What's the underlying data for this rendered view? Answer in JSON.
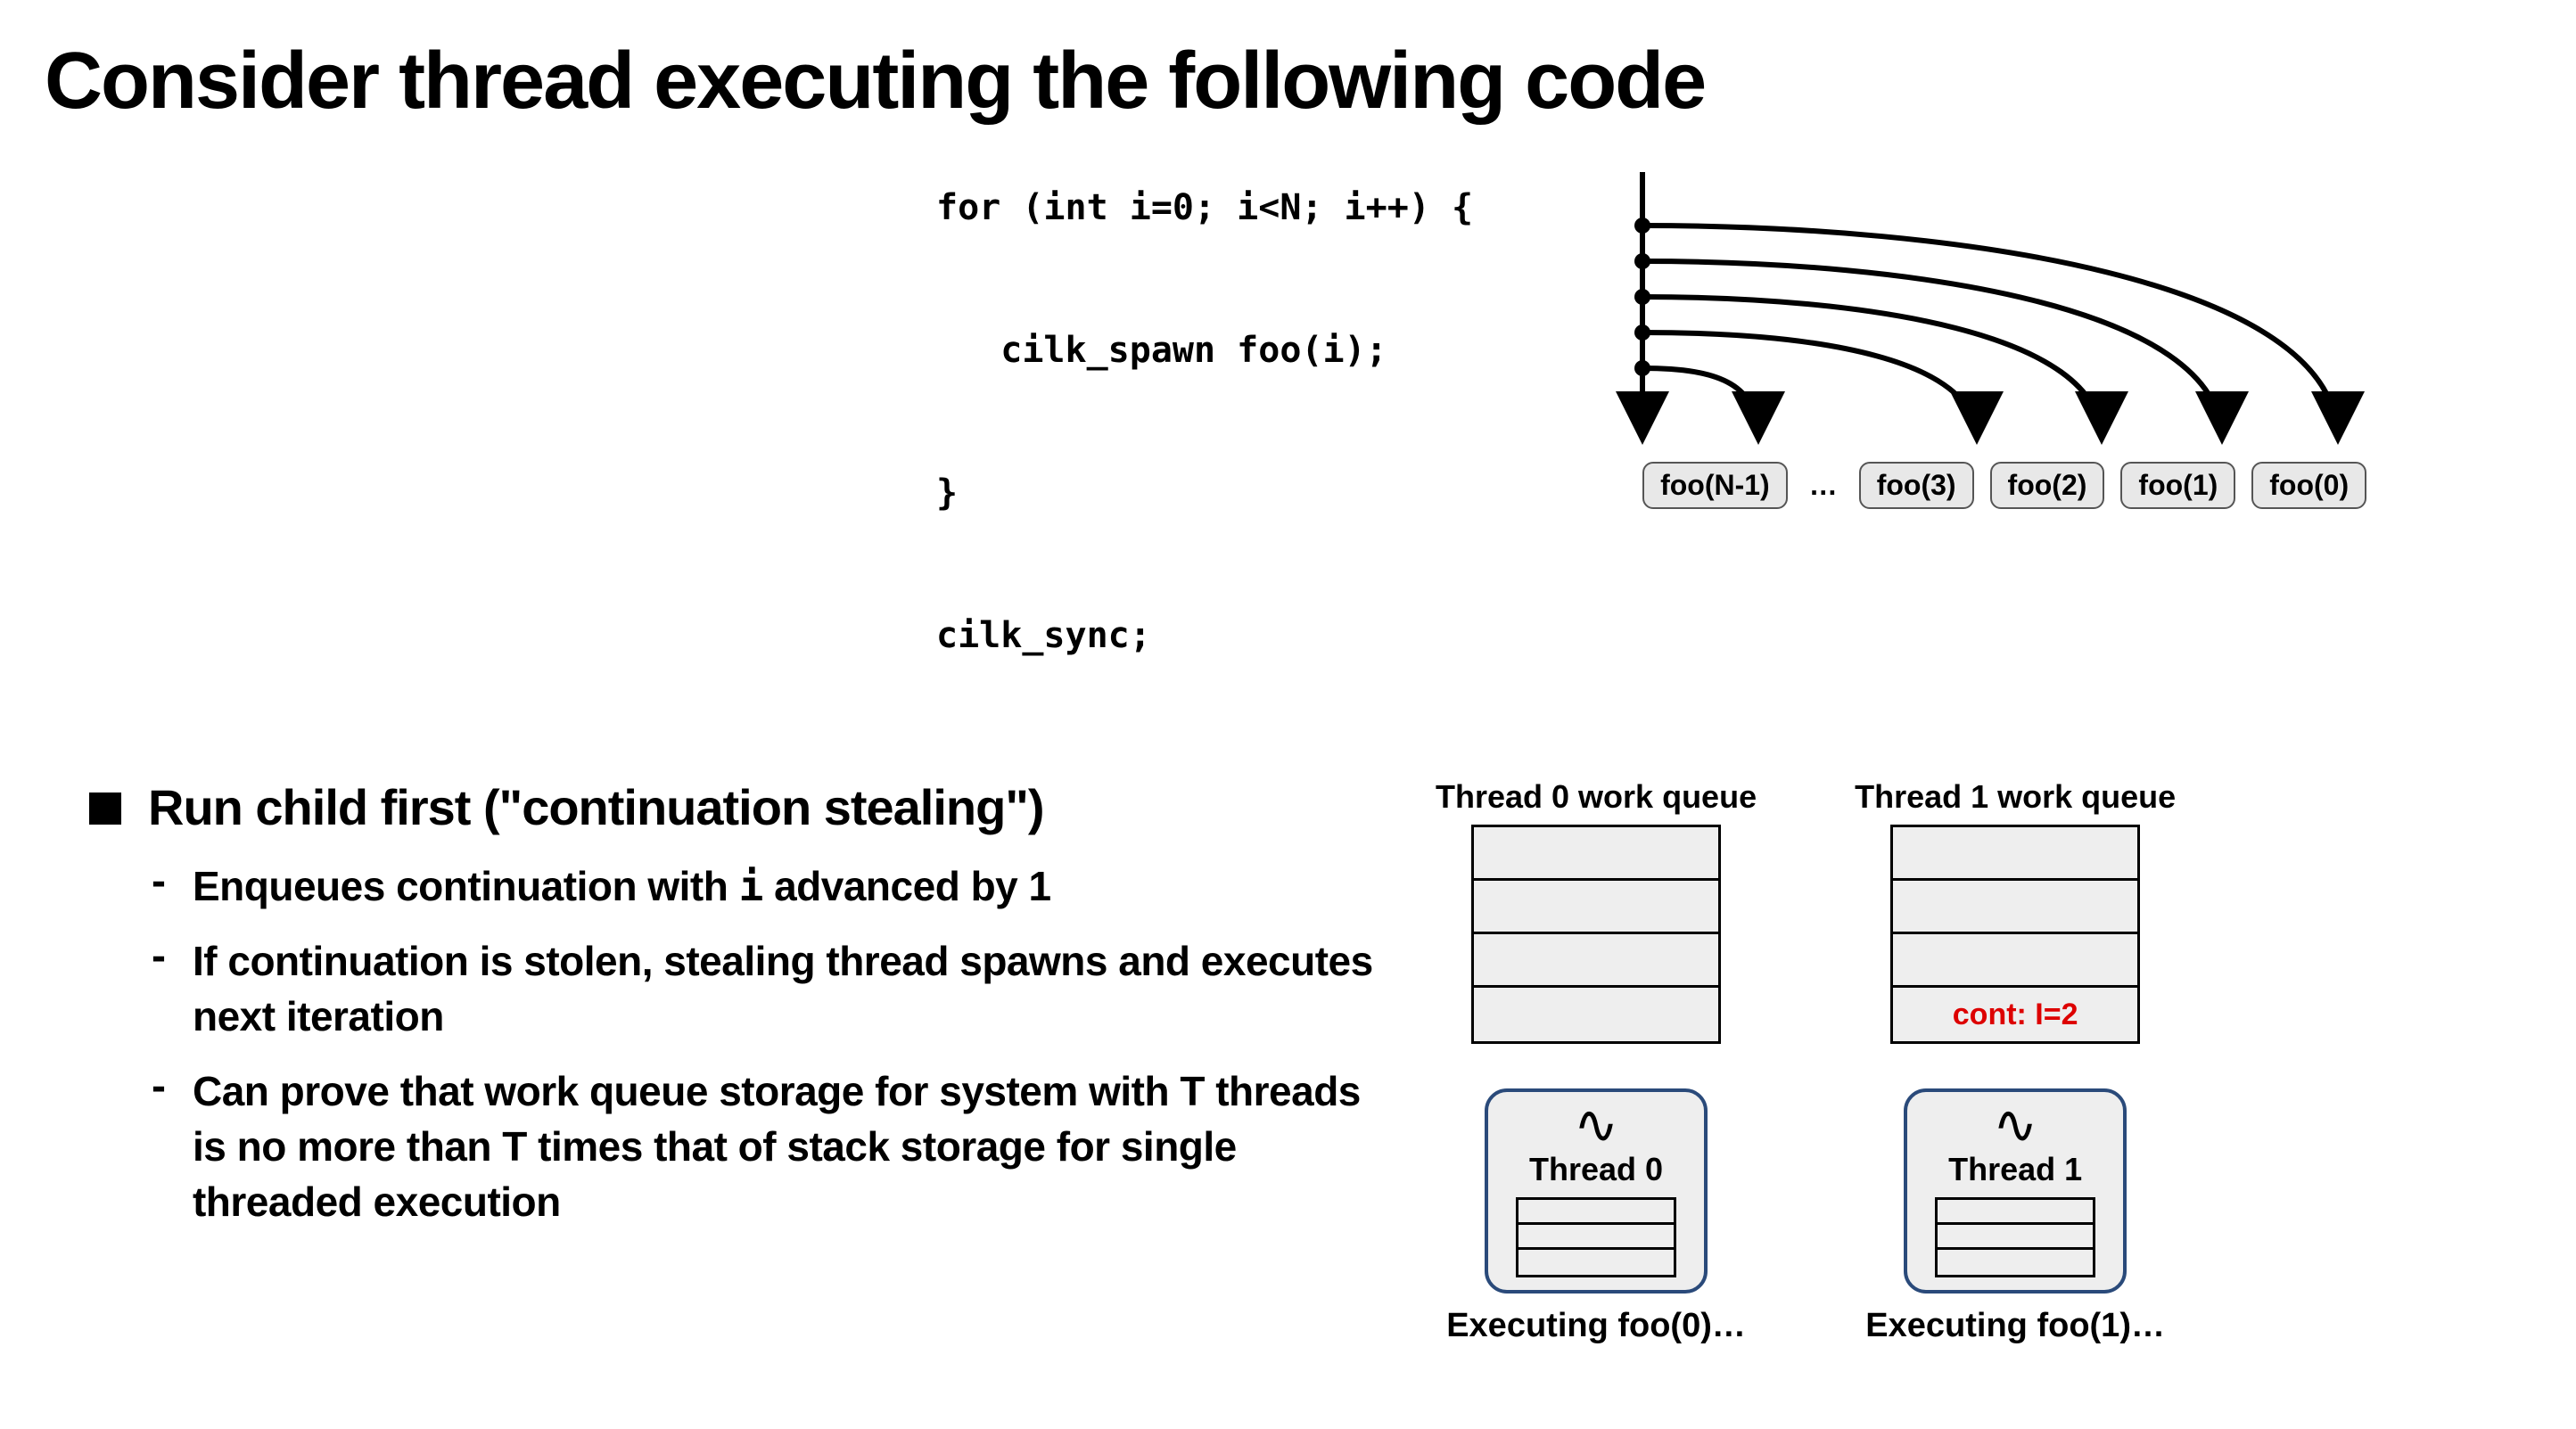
{
  "title": "Consider thread executing the following code",
  "code": "for (int i=0; i<N; i++) {\n\n   cilk_spawn foo(i);\n\n}\n\ncilk_sync;",
  "foo_boxes": [
    "foo(N-1)",
    "…",
    "foo(3)",
    "foo(2)",
    "foo(1)",
    "foo(0)"
  ],
  "bullet_main": "Run child first (\"continuation stealing\")",
  "sub1_a": "Enqueues continuation with ",
  "sub1_b": "i",
  "sub1_c": " advanced by 1",
  "sub2": "If continuation is stolen, stealing thread spawns and executes next iteration",
  "sub3": "Can prove that work queue storage for system with T threads is no more than T times that of stack storage for single threaded execution",
  "queue0": {
    "label": "Thread 0 work queue",
    "thread_label": "Thread 0",
    "exec": "Executing foo(0)…"
  },
  "queue1": {
    "label": "Thread 1 work queue",
    "cont_cell": "cont: I=2",
    "thread_label": "Thread 1",
    "exec": "Executing foo(1)…"
  }
}
